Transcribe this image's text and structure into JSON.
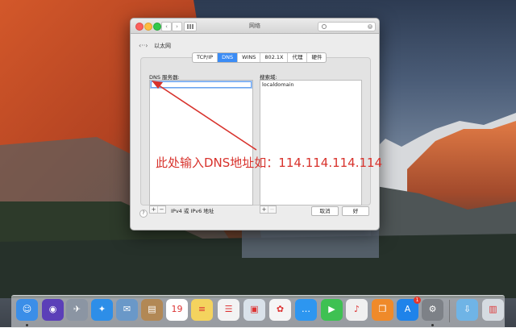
{
  "window": {
    "title": "网络",
    "nav_back": "‹",
    "nav_forward": "›",
    "search_icon": "magnifier-icon",
    "clear_glyph": "×",
    "breadcrumb_icon": "‹··›",
    "breadcrumb": "以太网"
  },
  "tabs": [
    {
      "label": "TCP/IP",
      "active": false
    },
    {
      "label": "DNS",
      "active": true
    },
    {
      "label": "WINS",
      "active": false
    },
    {
      "label": "802.1X",
      "active": false
    },
    {
      "label": "代理",
      "active": false
    },
    {
      "label": "硬件",
      "active": false
    }
  ],
  "dns": {
    "label": "DNS 服务器:",
    "current_value": "",
    "add": "+",
    "remove": "−",
    "hint": "IPv4 或 IPv6 地址"
  },
  "search_domains": {
    "label": "搜索域:",
    "items": [
      "localdomain"
    ],
    "add": "+",
    "remove": "−"
  },
  "footer": {
    "help": "?",
    "cancel": "取消",
    "ok": "好"
  },
  "annotation": {
    "text": "此处输入DNS地址如：114.114.114.114",
    "color": "#d8322c"
  },
  "dock": [
    {
      "name": "finder-icon",
      "glyph": "☺",
      "color": "#3b8ee8",
      "running": true
    },
    {
      "name": "siri-icon",
      "glyph": "◉",
      "color": "#5b3fb8",
      "running": false
    },
    {
      "name": "launchpad-icon",
      "glyph": "✈",
      "color": "#8b95a3",
      "running": false
    },
    {
      "name": "safari-icon",
      "glyph": "✦",
      "color": "#2d8ee8",
      "running": false
    },
    {
      "name": "preview-icon",
      "glyph": "✉",
      "color": "#6a98c8",
      "running": false
    },
    {
      "name": "contacts-icon",
      "glyph": "▤",
      "color": "#b28855",
      "running": false
    },
    {
      "name": "calendar-icon",
      "glyph": "19",
      "color": "#ffffff",
      "running": false
    },
    {
      "name": "notes-icon",
      "glyph": "≡",
      "color": "#f4d35e",
      "running": false
    },
    {
      "name": "reminders-icon",
      "glyph": "☰",
      "color": "#f3f3f3",
      "running": false
    },
    {
      "name": "photo-booth-icon",
      "glyph": "▣",
      "color": "#d9e2ea",
      "running": false
    },
    {
      "name": "photos-icon",
      "glyph": "✿",
      "color": "#f5f5f5",
      "running": false
    },
    {
      "name": "messages-icon",
      "glyph": "…",
      "color": "#2d96f0",
      "running": false
    },
    {
      "name": "facetime-icon",
      "glyph": "▶",
      "color": "#3ec152",
      "running": false
    },
    {
      "name": "music-icon",
      "glyph": "♪",
      "color": "#f0f0f0",
      "running": false
    },
    {
      "name": "books-icon",
      "glyph": "❐",
      "color": "#ef8a2a",
      "running": false
    },
    {
      "name": "app-store-icon",
      "glyph": "A",
      "color": "#1f83ea",
      "running": false,
      "badge": "1"
    },
    {
      "name": "system-preferences-icon",
      "glyph": "⚙",
      "color": "#7d8187",
      "running": true
    },
    {
      "name": "downloads-folder-icon",
      "glyph": "⇩",
      "color": "#6fb4e6",
      "running": false
    },
    {
      "name": "trash-icon",
      "glyph": "▥",
      "color": "#d5dbe1",
      "running": false
    }
  ]
}
